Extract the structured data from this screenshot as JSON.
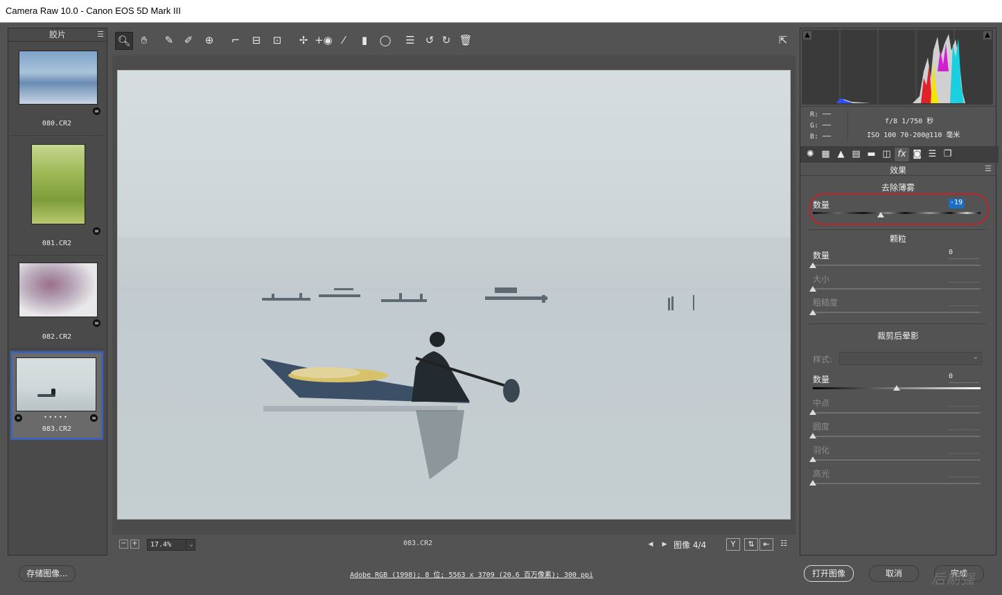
{
  "window": {
    "title": "Camera Raw 10.0 -  Canon EOS 5D Mark III"
  },
  "filmstrip": {
    "title": "胶片",
    "items": [
      {
        "name": "080.CR2",
        "selected": false
      },
      {
        "name": "081.CR2",
        "selected": false
      },
      {
        "name": "082.CR2",
        "selected": false
      },
      {
        "name": "083.CR2",
        "selected": true,
        "rating_dots": "• • • • •"
      }
    ]
  },
  "toolbar": {
    "tools": [
      "zoom-icon",
      "hand-icon",
      "white-balance-icon",
      "color-sampler-icon",
      "targeted-adjustment-icon",
      "crop-icon",
      "straighten-icon",
      "transform-icon",
      "spot-removal-icon",
      "red-eye-icon",
      "adjustment-brush-icon",
      "graduated-filter-icon",
      "radial-filter-icon",
      "preferences-icon",
      "rotate-left-icon",
      "rotate-right-icon",
      "trash-icon"
    ]
  },
  "status": {
    "zoom": "17.4%",
    "filename": "083.CR2",
    "image_label": "图像 4/4"
  },
  "info": {
    "r": "R:  ──",
    "g": "G:  ──",
    "b": "B:  ──",
    "exposure": "f/8  1/750 秒",
    "iso_lens": "ISO 100  70-200@110 毫米"
  },
  "panel": {
    "title": "效果",
    "dehaze": {
      "title": "去除薄雾",
      "amount_label": "数量",
      "amount": "-19",
      "amount_fraction": 0.405
    },
    "grain": {
      "title": "颗粒",
      "amount_label": "数量",
      "amount": "0",
      "size_label": "大小",
      "roughness_label": "粗糙度"
    },
    "vignette": {
      "title": "裁剪后晕影",
      "style_label": "样式:",
      "amount_label": "数量",
      "amount": "0",
      "amount_fraction": 0.5,
      "midpoint_label": "中点",
      "roundness_label": "圆度",
      "feather_label": "羽化",
      "highlights_label": "高光"
    }
  },
  "bottom": {
    "save_label": "存储图像...",
    "workflow": "Adobe RGB (1998); 8 位; 5563 x 3709 (20.6 百万像素); 300 ppi",
    "open_label": "打开图像",
    "cancel_label": "取消",
    "done_label": "完成",
    "watermark": "后期强"
  }
}
